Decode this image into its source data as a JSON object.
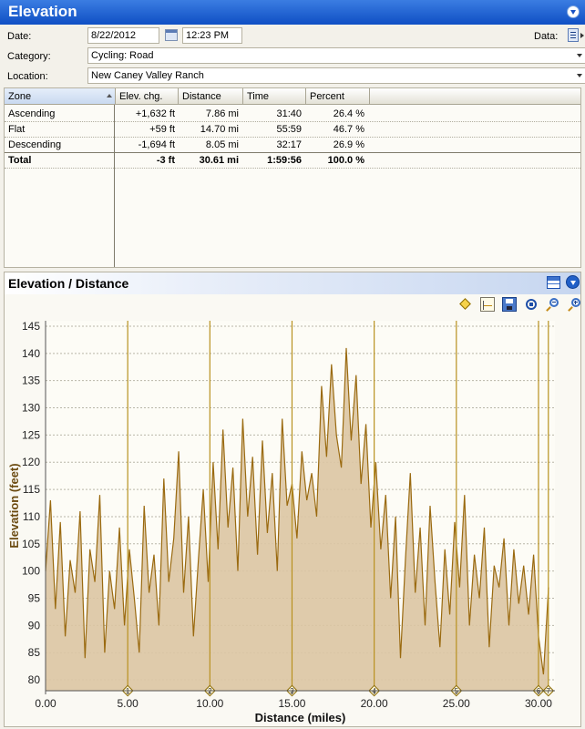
{
  "title": "Elevation",
  "form": {
    "date_label": "Date:",
    "date_value": "8/22/2012",
    "time_value": "12:23 PM",
    "data_label": "Data:",
    "category_label": "Category:",
    "category_value": "Cycling: Road",
    "location_label": "Location:",
    "location_value": "New Caney  Valley Ranch"
  },
  "table": {
    "columns": [
      "Zone",
      "Elev. chg.",
      "Distance",
      "Time",
      "Percent"
    ],
    "rows": [
      [
        "Ascending",
        "+1,632 ft",
        "7.86 mi",
        "31:40",
        "26.4 %"
      ],
      [
        "Flat",
        "+59 ft",
        "14.70 mi",
        "55:59",
        "46.7 %"
      ],
      [
        "Descending",
        "-1,694 ft",
        "8.05 mi",
        "32:17",
        "26.9 %"
      ],
      [
        "Total",
        "-3 ft",
        "30.61 mi",
        "1:59:56",
        "100.0 %"
      ]
    ]
  },
  "chart_section": {
    "title": "Elevation / Distance",
    "toolbar_icons": [
      "diamond-marker-icon",
      "chart-settings-icon",
      "save-icon",
      "fit-view-icon",
      "zoom-out-icon",
      "zoom-in-icon"
    ]
  },
  "chart_data": {
    "type": "area",
    "xlabel": "Distance (miles)",
    "ylabel": "Elevation (feet)",
    "xlim": [
      0,
      31
    ],
    "ylim": [
      78,
      146
    ],
    "x_ticks": [
      "0.00",
      "5.00",
      "10.00",
      "15.00",
      "20.00",
      "25.00",
      "30.00"
    ],
    "y_ticks": [
      "80",
      "85",
      "90",
      "95",
      "100",
      "105",
      "110",
      "115",
      "120",
      "125",
      "130",
      "135",
      "140",
      "145"
    ],
    "grid": true,
    "colors": {
      "line": "#9a6a10",
      "fill": "#dcc5a3",
      "marker_line": "#b8911f",
      "plot_bg": "#fdfcf6"
    },
    "mile_markers": [
      {
        "label": "1",
        "x": 5.0
      },
      {
        "label": "2",
        "x": 10.0
      },
      {
        "label": "3",
        "x": 15.0
      },
      {
        "label": "4",
        "x": 20.0
      },
      {
        "label": "5",
        "x": 25.0
      },
      {
        "label": "6",
        "x": 30.0
      },
      {
        "label": "7",
        "x": 30.6
      }
    ],
    "profile": {
      "x": [
        0,
        0.3,
        0.6,
        0.9,
        1.2,
        1.5,
        1.8,
        2.1,
        2.4,
        2.7,
        3.0,
        3.3,
        3.6,
        3.9,
        4.2,
        4.5,
        4.8,
        5.1,
        5.4,
        5.7,
        6.0,
        6.3,
        6.6,
        6.9,
        7.2,
        7.5,
        7.8,
        8.1,
        8.4,
        8.7,
        9.0,
        9.3,
        9.6,
        9.9,
        10.2,
        10.5,
        10.8,
        11.1,
        11.4,
        11.7,
        12.0,
        12.3,
        12.6,
        12.9,
        13.2,
        13.5,
        13.8,
        14.1,
        14.4,
        14.7,
        15.0,
        15.3,
        15.6,
        15.9,
        16.2,
        16.5,
        16.8,
        17.1,
        17.4,
        17.7,
        18.0,
        18.3,
        18.6,
        18.9,
        19.2,
        19.5,
        19.8,
        20.1,
        20.4,
        20.7,
        21.0,
        21.3,
        21.6,
        21.9,
        22.2,
        22.5,
        22.8,
        23.1,
        23.4,
        23.7,
        24.0,
        24.3,
        24.6,
        24.9,
        25.2,
        25.5,
        25.8,
        26.1,
        26.4,
        26.7,
        27.0,
        27.3,
        27.6,
        27.9,
        28.2,
        28.5,
        28.8,
        29.1,
        29.4,
        29.7,
        30.0,
        30.3,
        30.61
      ],
      "y": [
        100,
        113,
        93,
        109,
        88,
        102,
        96,
        111,
        84,
        104,
        98,
        114,
        85,
        100,
        93,
        108,
        90,
        104,
        95,
        85,
        112,
        96,
        103,
        90,
        117,
        98,
        106,
        122,
        96,
        110,
        88,
        102,
        115,
        98,
        120,
        104,
        126,
        108,
        119,
        100,
        128,
        110,
        121,
        103,
        124,
        107,
        118,
        100,
        128,
        112,
        116,
        106,
        122,
        113,
        118,
        110,
        134,
        121,
        138,
        125,
        119,
        141,
        124,
        136,
        116,
        127,
        108,
        120,
        104,
        114,
        95,
        110,
        84,
        102,
        118,
        96,
        108,
        90,
        112,
        98,
        86,
        104,
        92,
        109,
        97,
        114,
        90,
        103,
        95,
        108,
        86,
        101,
        97,
        106,
        90,
        104,
        94,
        101,
        92,
        103,
        88,
        81,
        97
      ]
    }
  }
}
